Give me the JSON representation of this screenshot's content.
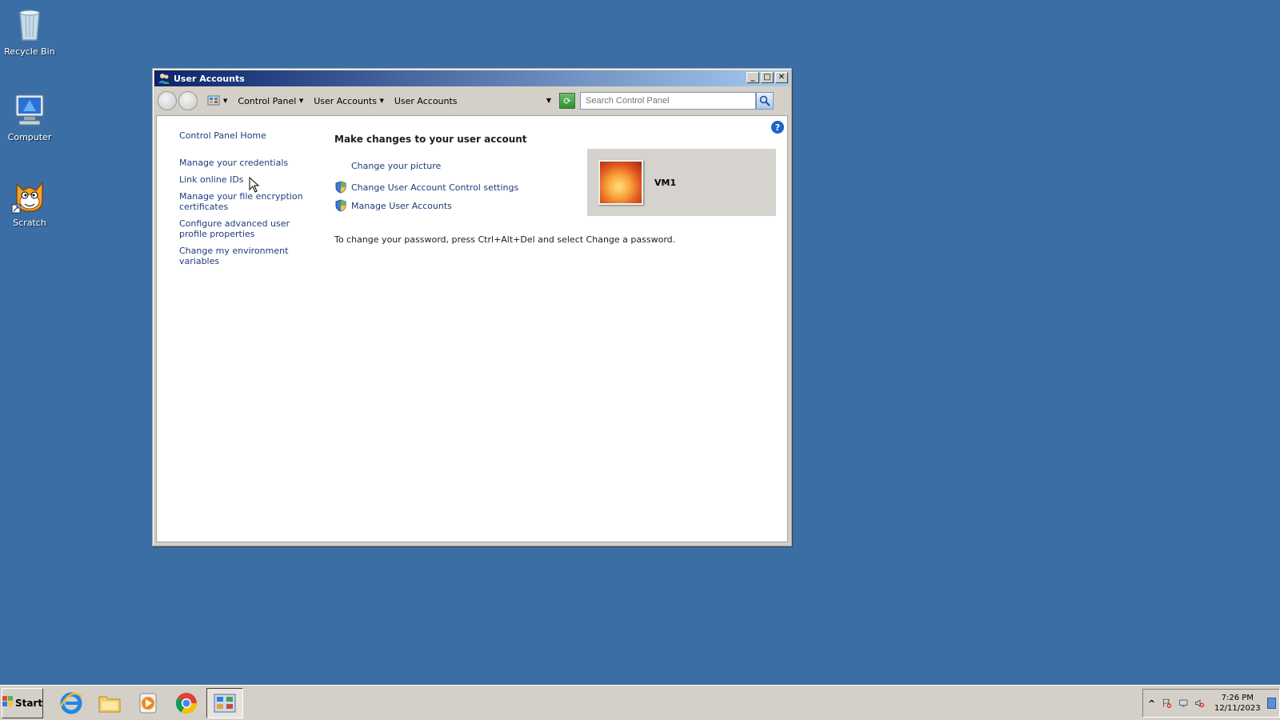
{
  "desktop": {
    "icons": [
      {
        "label": "Recycle Bin",
        "icon": "recycle-bin-icon"
      },
      {
        "label": "Computer",
        "icon": "computer-icon"
      },
      {
        "label": "Scratch",
        "icon": "scratch-icon"
      }
    ]
  },
  "window": {
    "title": "User Accounts",
    "title_buttons": {
      "minimize": "_",
      "maximize": "□",
      "close": "✕"
    }
  },
  "navbar": {
    "breadcrumbs": [
      "Control Panel",
      "User Accounts",
      "User Accounts"
    ],
    "search_placeholder": "Search Control Panel"
  },
  "sidebar": {
    "items": [
      "Control Panel Home",
      "Manage your credentials",
      "Link online IDs",
      "Manage your file encryption certificates",
      "Configure advanced user profile properties",
      "Change my environment variables"
    ]
  },
  "main": {
    "title": "Make changes to your user account",
    "tasks": [
      {
        "label": "Change your picture",
        "icon": ""
      },
      {
        "label": "Change User Account Control settings",
        "icon": "shield-icon"
      },
      {
        "label": "Manage User Accounts",
        "icon": "shield-icon"
      }
    ],
    "password_note": "To change your password, press Ctrl+Alt+Del and select Change a password."
  },
  "user_card": {
    "name": "VM1"
  },
  "taskbar": {
    "start_label": "Start",
    "apps": [
      "internet-explorer-icon",
      "file-explorer-icon",
      "media-player-icon",
      "chrome-icon",
      "control-panel-icon"
    ],
    "clock_time": "7:26 PM",
    "clock_date": "12/11/2023",
    "tray_expand": "^"
  },
  "help_glyph": "?"
}
